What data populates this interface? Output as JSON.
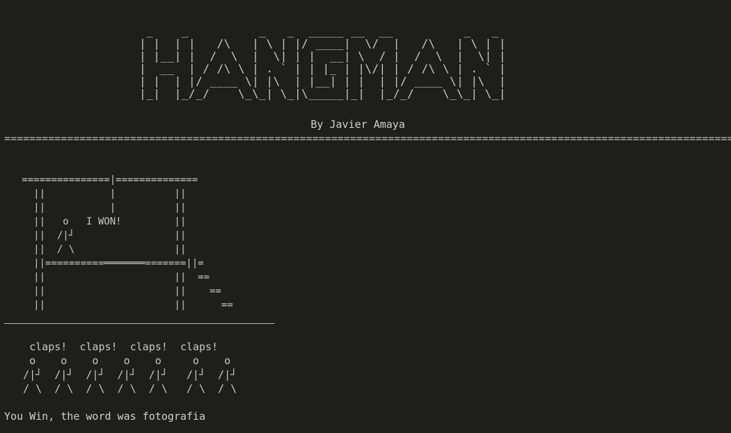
{
  "banner": {
    "ascii_art": " _    _          _   _  _____ __  __          _   _ \n| |  | |   /\\   | \\ | |/ ____|  \\/  |   /\\   | \\ | |\n| |__| |  /  \\  |  \\| | |  __| \\  / |  /  \\  |  \\| |\n|  __  | / /\\ \\ | . ` | | |_ | |\\/| | / /\\ \\ | . ` |\n| |  | |/ ____ \\| |\\  | |__| | |  | |/ ____ \\| |\\  |\n|_|  |_/_/    \\_\\_| \\_|\\_____|_|  |_/_/    \\_\\_| \\_|"
  },
  "byline": "By Javier Amaya",
  "separator": "========================================================================================================================",
  "gallows": {
    "ascii_art": "   ===============|==============\n     ||           |          ||\n     ||           |          ||\n     ||   o   I WON!         ||\n     ||  /|┘                 ||\n     ||  / \\                 ||\n     ||==========═══════=======||=\n     ||                      ||  ==\n     ||                      ||    ==\n     ||                      ||      =="
  },
  "celebration": {
    "ascii_art": "    claps!  claps!  claps!  claps!\n    o    o    o    o    o     o    o\n   /|┘  /|┘  /|┘  /|┘  /|┘   /|┘  /|┘\n   / \\  / \\  / \\  / \\  / \\   / \\  / \\"
  },
  "result_message": "You Win, the word was fotografia"
}
